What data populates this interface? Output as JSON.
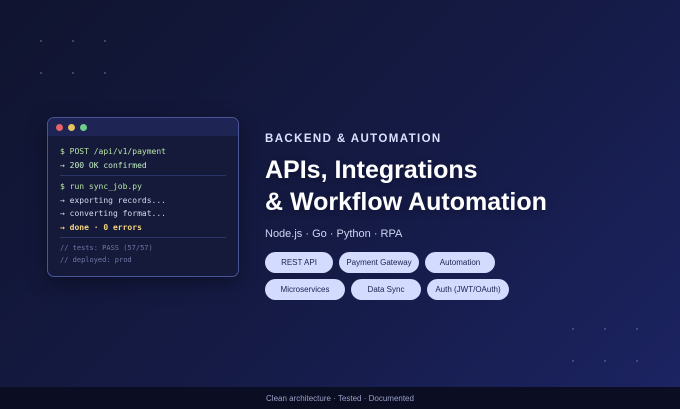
{
  "terminal": {
    "lines": [
      "$ POST /api/v1/payment",
      "→ 200 OK confirmed",
      "$ run sync_job.py",
      "→ exporting records...",
      "→ converting format...",
      "→ done · 0 errors",
      "// tests: PASS (57/57)",
      "// deployed: prod"
    ]
  },
  "hero": {
    "eyebrow": "BACKEND & AUTOMATION",
    "headline_line1": "APIs, Integrations",
    "headline_line2": "& Workflow Automation",
    "stack": "Node.js · Go · Python · RPA"
  },
  "chips": [
    "REST API",
    "Payment Gateway",
    "Automation",
    "Microservices",
    "Data Sync",
    "Auth (JWT/OAuth)"
  ],
  "footer": {
    "text": "Clean architecture · Tested · Documented"
  },
  "colors": {
    "background": "#151b46",
    "chip": "#d3dcff",
    "terminal_border": "#4a5598"
  }
}
